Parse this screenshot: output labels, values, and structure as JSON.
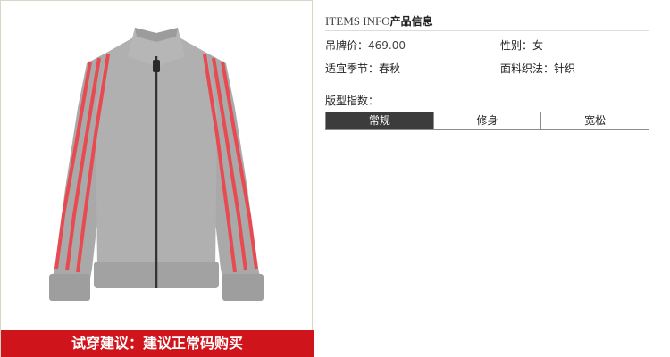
{
  "product": {
    "banner": "试穿建议：建议正常码购买",
    "colors": {
      "jacket": "#a8a8a8",
      "stripes": "#e84a52",
      "banner": "#d0141c"
    }
  },
  "info": {
    "header_en": "ITEMS INFO",
    "header_cn": "产品信息",
    "price_label": "吊牌价：",
    "price_value": "469.00",
    "gender_label": "性别：",
    "gender_value": "女",
    "season_label": "适宜季节：",
    "season_value": "春秋",
    "fabric_label": "面料织法：",
    "fabric_value": "针织",
    "fit_label": "版型指数：",
    "fit_options": [
      "常规",
      "修身",
      "宽松"
    ],
    "fit_selected": "常规"
  }
}
